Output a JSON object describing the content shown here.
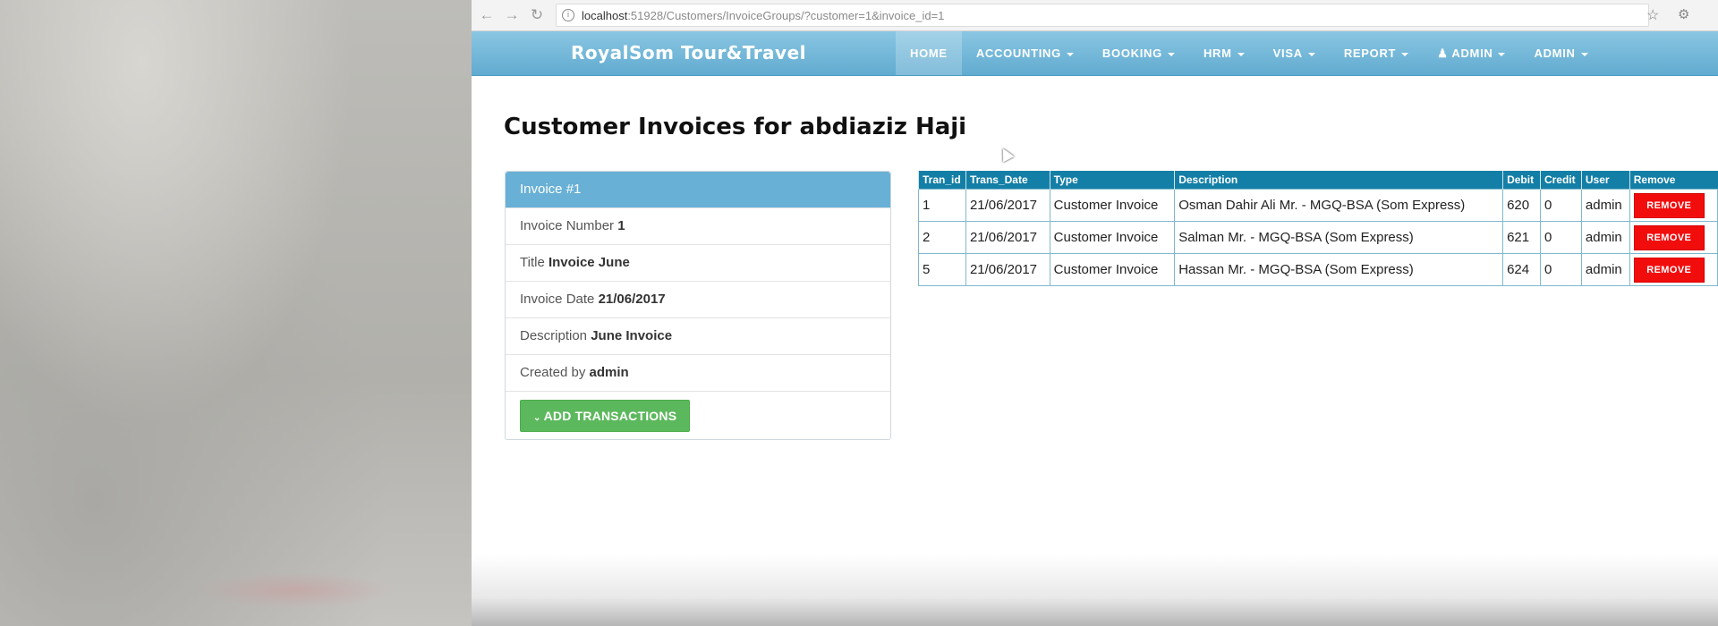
{
  "browser": {
    "url_host": "localhost",
    "url_path": ":51928/Customers/InvoiceGroups/?customer=1&invoice_id=1",
    "back_icon": "arrow-left",
    "forward_icon": "arrow-right",
    "reload_icon": "refresh",
    "bookmark_icon": "star"
  },
  "navbar": {
    "brand": "RoyalSom Tour&Travel",
    "items": [
      {
        "label": "HOME",
        "active": true,
        "dropdown": false
      },
      {
        "label": "ACCOUNTING",
        "dropdown": true
      },
      {
        "label": "BOOKING",
        "dropdown": true
      },
      {
        "label": "HRM",
        "dropdown": true
      },
      {
        "label": "VISA",
        "dropdown": true
      },
      {
        "label": "REPORT",
        "dropdown": true
      },
      {
        "label": "ADMIN",
        "dropdown": true,
        "icon": "user-icon"
      },
      {
        "label": "ADMIN",
        "dropdown": true
      }
    ]
  },
  "page": {
    "title": "Customer Invoices for abdiaziz Haji"
  },
  "invoice_panel": {
    "heading": "Invoice #1",
    "rows": [
      {
        "label": "Invoice Number",
        "value": "1"
      },
      {
        "label": "Title",
        "value": "Invoice June"
      },
      {
        "label": "Invoice Date",
        "value": "21/06/2017"
      },
      {
        "label": "Description",
        "value": "June Invoice"
      },
      {
        "label": "Created by",
        "value": "admin"
      }
    ],
    "add_button": "ADD TRANSACTIONS"
  },
  "transactions": {
    "headers": [
      "Tran_id",
      "Trans_Date",
      "Type",
      "Description",
      "Debit",
      "Credit",
      "User",
      "Remove"
    ],
    "rows": [
      {
        "tran_id": "1",
        "date": "21/06/2017",
        "type": "Customer Invoice",
        "description": "Osman Dahir Ali Mr. - MGQ-BSA (Som Express)",
        "debit": "620",
        "credit": "0",
        "user": "admin",
        "action": "REMOVE"
      },
      {
        "tran_id": "2",
        "date": "21/06/2017",
        "type": "Customer Invoice",
        "description": "Salman Mr. - MGQ-BSA (Som Express)",
        "debit": "621",
        "credit": "0",
        "user": "admin",
        "action": "REMOVE"
      },
      {
        "tran_id": "5",
        "date": "21/06/2017",
        "type": "Customer Invoice",
        "description": "Hassan Mr. - MGQ-BSA (Som Express)",
        "debit": "624",
        "credit": "0",
        "user": "admin",
        "action": "REMOVE"
      }
    ]
  },
  "colors": {
    "navbar": "#61abd0",
    "panel_heading": "#68b0d5",
    "table_header": "#147fa6",
    "add_button": "#5cb85c",
    "remove_button": "#f20d0d"
  }
}
